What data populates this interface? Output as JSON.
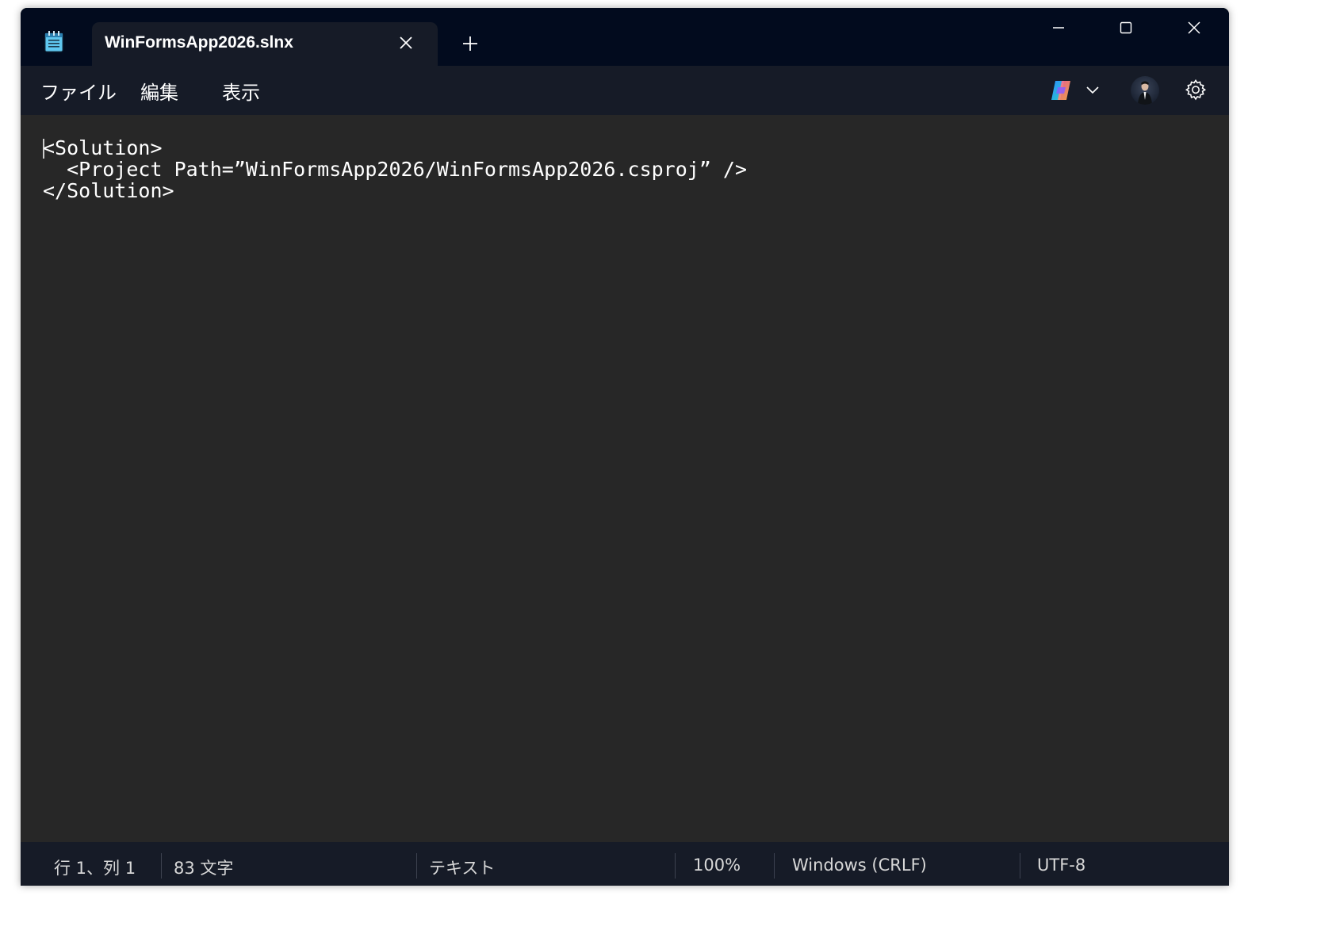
{
  "tab": {
    "title": "WinFormsApp2026.slnx"
  },
  "menu": {
    "items": [
      {
        "label": "ファイル"
      },
      {
        "label": "編集"
      },
      {
        "label": "表示"
      }
    ]
  },
  "editor": {
    "lines": [
      "<Solution>",
      "  <Project Path=”WinFormsApp2026/WinFormsApp2026.csproj” />",
      "</Solution>"
    ]
  },
  "status": {
    "position": "行 1、列 1",
    "char_count": "83 文字",
    "format": "テキスト",
    "zoom": "100%",
    "line_ending": "Windows (CRLF)",
    "encoding": "UTF-8"
  },
  "icons": {
    "app": "notepad-icon",
    "close_tab": "close-icon",
    "new_tab": "plus-icon",
    "minimize": "minimize-icon",
    "maximize": "maximize-icon",
    "close_window": "close-icon",
    "copilot": "copilot-icon",
    "chevron": "chevron-down-icon",
    "avatar": "avatar",
    "settings": "gear-icon"
  },
  "colors": {
    "titlebar": "#020b1e",
    "menubar": "#161b27",
    "editor": "#272727",
    "text": "#ffffff",
    "app_icon": "#4fc3f7"
  }
}
